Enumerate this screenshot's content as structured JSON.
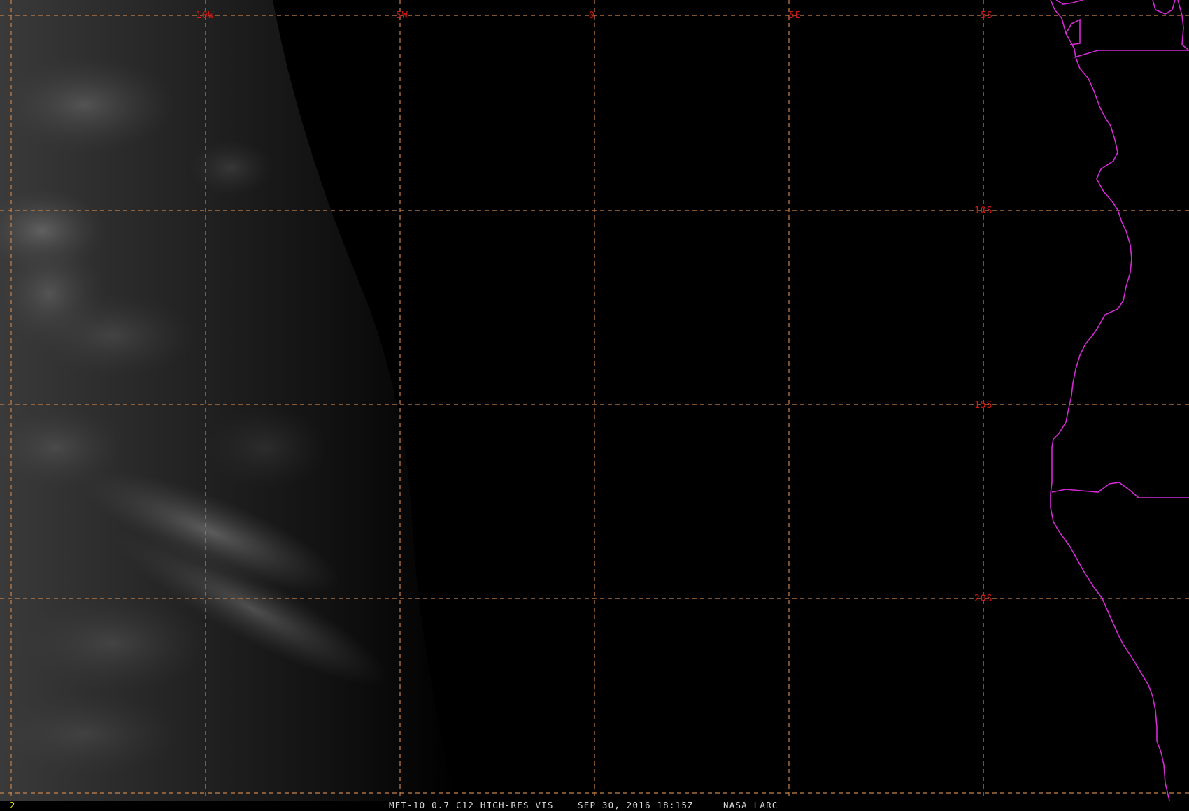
{
  "map": {
    "longitude_labels": [
      "10W",
      "5W",
      "0",
      "5E"
    ],
    "latitude_labels": [
      "5S",
      "10S",
      "15S",
      "20S"
    ],
    "grid_color": "#c8824a",
    "label_color": "#d41a14",
    "coastline_color": "#d42ad4",
    "background_color": "#000000"
  },
  "status_bar": {
    "frame_number": "2",
    "product": "MET-10 0.7 C12 HIGH-RES VIS",
    "datetime": "SEP 30, 2016 18:15Z",
    "source": "NASA LARC"
  }
}
